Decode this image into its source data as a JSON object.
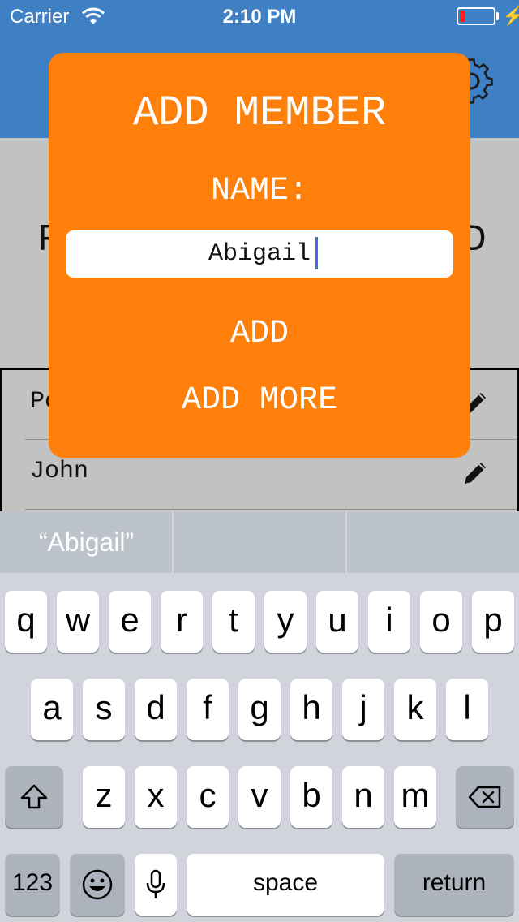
{
  "status_bar": {
    "carrier": "Carrier",
    "time": "2:10 PM",
    "battery_level": 0.15,
    "battery_color": "#ff1f1f"
  },
  "navbar": {
    "color": "#3f7fc4",
    "settings_icon": "gear-icon"
  },
  "background": {
    "partial_left_char": "F",
    "partial_right_char": "D",
    "members": [
      {
        "name": "Po",
        "icon": "pencil-icon"
      },
      {
        "name": "John",
        "icon": "pencil-icon"
      }
    ]
  },
  "modal": {
    "color": "#fe7f0a",
    "title": "ADD MEMBER",
    "name_label": "NAME:",
    "name_value": "Abigail",
    "add_label": "ADD",
    "add_more_label": "ADD MORE"
  },
  "keyboard": {
    "suggestions": [
      "“Abigail”",
      "",
      ""
    ],
    "row1": [
      "q",
      "w",
      "e",
      "r",
      "t",
      "y",
      "u",
      "i",
      "o",
      "p"
    ],
    "row2": [
      "a",
      "s",
      "d",
      "f",
      "g",
      "h",
      "j",
      "k",
      "l"
    ],
    "row3": [
      "z",
      "x",
      "c",
      "v",
      "b",
      "n",
      "m"
    ],
    "numbers_label": "123",
    "space_label": "space",
    "return_label": "return",
    "shift_icon": "shift-icon",
    "delete_icon": "backspace-icon",
    "emoji_icon": "emoji-icon",
    "mic_icon": "microphone-icon"
  }
}
